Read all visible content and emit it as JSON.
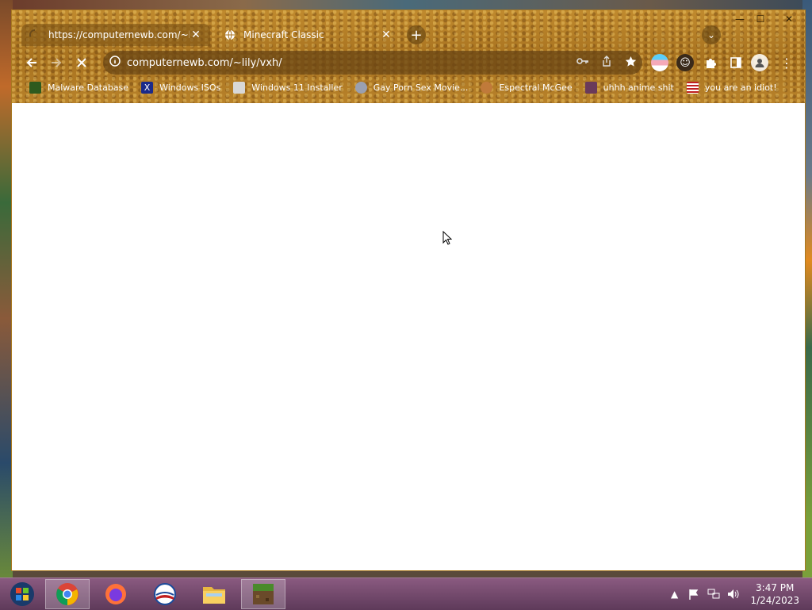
{
  "window": {
    "controls": {
      "minimize": "—",
      "maximize": "☐",
      "close": "✕"
    }
  },
  "tabs": [
    {
      "label": "https://computernewb.com/~lily/",
      "loading": true,
      "close": "✕"
    },
    {
      "label": "Minecraft Classic",
      "loading": false,
      "close": "✕"
    }
  ],
  "toolbar": {
    "url": "computernewb.com/~lily/vxh/",
    "new_tab_icon": "+",
    "tab_search_icon": "⌄"
  },
  "bookmarks": [
    {
      "label": "Malware Database",
      "icon": "virus-icon",
      "color": "#2e5a1e"
    },
    {
      "label": "Windows ISOs",
      "icon": "x-icon",
      "color": "#1a2a8a"
    },
    {
      "label": "Windows 11 Installer",
      "icon": "installer-icon",
      "color": "#d8d8d8"
    },
    {
      "label": "Gay Porn Sex Movie...",
      "icon": "disc-icon",
      "color": "#9aa0b0"
    },
    {
      "label": "Espectral McGee",
      "icon": "face-icon",
      "color": "#c07a3a"
    },
    {
      "label": "uhhh anime shit",
      "icon": "anime-icon",
      "color": "#6a3a5a"
    },
    {
      "label": "you are an idiot!",
      "icon": "flag-icon",
      "color": "#c02020"
    }
  ],
  "taskbar": {
    "apps": [
      {
        "name": "start-button"
      },
      {
        "name": "chrome"
      },
      {
        "name": "firefox"
      },
      {
        "name": "obama"
      },
      {
        "name": "file-explorer"
      },
      {
        "name": "minecraft"
      }
    ],
    "clock": {
      "time": "3:47 PM",
      "date": "1/24/2023"
    },
    "colors": {
      "taskbar": "#6e4668"
    }
  }
}
